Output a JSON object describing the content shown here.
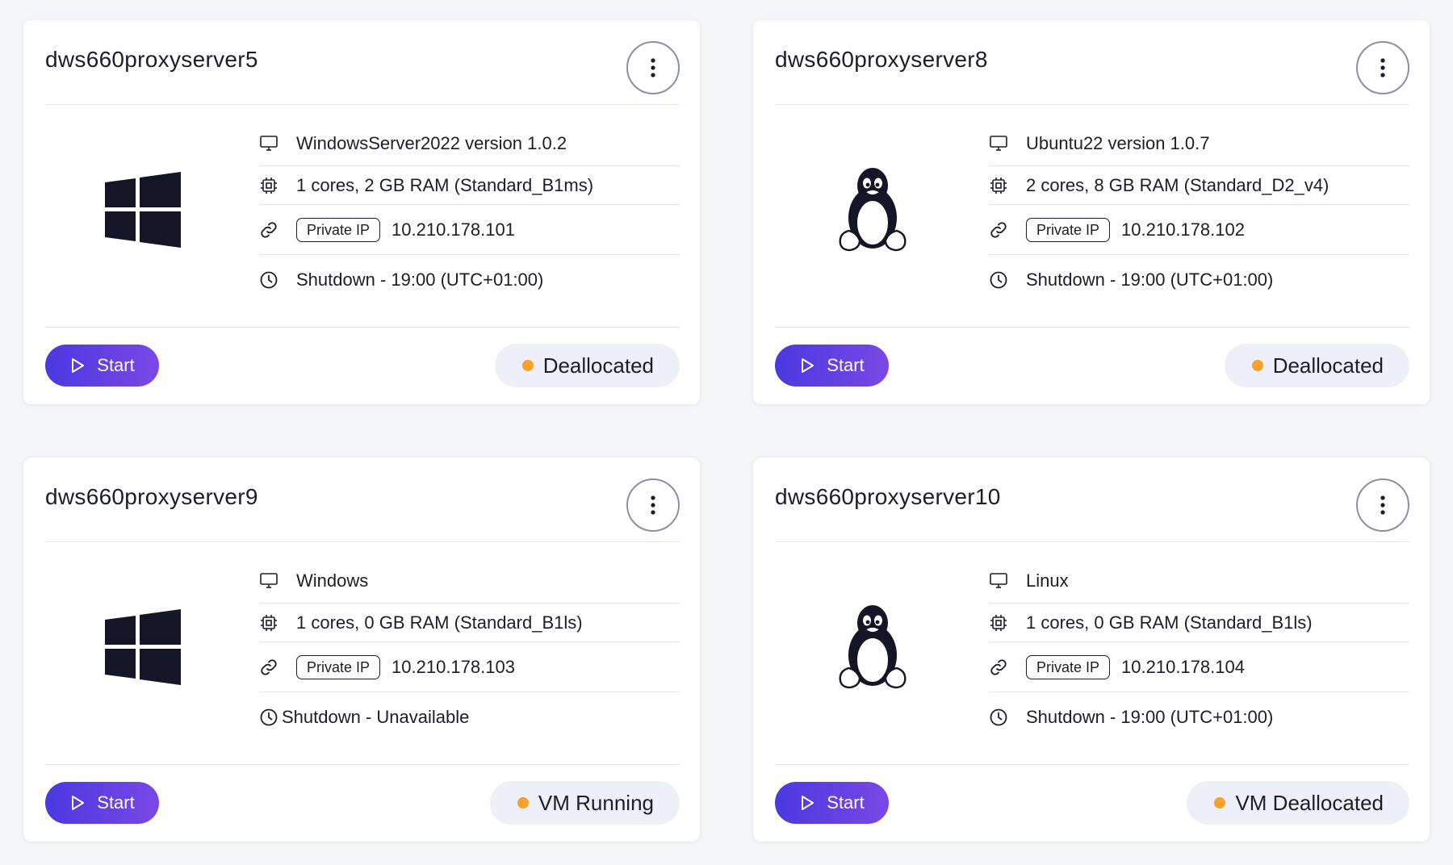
{
  "colors": {
    "accent_start": "#4a3ae0",
    "accent_end": "#7a47e6",
    "status_dot": "#f5a12b",
    "card_bg": "#ffffff",
    "page_bg": "#f5f6fa"
  },
  "cards": [
    {
      "title": "dws660proxyserver5",
      "os_icon": "windows-logo-icon",
      "image": "WindowsServer2022 version 1.0.2",
      "specs": "1 cores, 2 GB RAM (Standard_B1ms)",
      "ip_label": "Private IP",
      "ip": "10.210.178.101",
      "shutdown": "Shutdown -  19:00  (UTC+01:00)",
      "start_label": "Start",
      "status": "Deallocated"
    },
    {
      "title": "dws660proxyserver8",
      "os_icon": "linux-tux-icon",
      "image": "Ubuntu22 version 1.0.7",
      "specs": "2 cores, 8 GB RAM (Standard_D2_v4)",
      "ip_label": "Private IP",
      "ip": "10.210.178.102",
      "shutdown": "Shutdown -  19:00  (UTC+01:00)",
      "start_label": "Start",
      "status": "Deallocated"
    },
    {
      "title": "dws660proxyserver9",
      "os_icon": "windows-logo-icon",
      "image": "Windows",
      "specs": "1 cores, 0 GB RAM (Standard_B1ls)",
      "ip_label": "Private IP",
      "ip": "10.210.178.103",
      "shutdown": "Shutdown - Unavailable",
      "start_label": "Start",
      "status": "VM Running"
    },
    {
      "title": "dws660proxyserver10",
      "os_icon": "linux-tux-icon",
      "image": "Linux",
      "specs": "1 cores, 0 GB RAM (Standard_B1ls)",
      "ip_label": "Private IP",
      "ip": "10.210.178.104",
      "shutdown": "Shutdown -  19:00  (UTC+01:00)",
      "start_label": "Start",
      "status": "VM Deallocated"
    }
  ]
}
